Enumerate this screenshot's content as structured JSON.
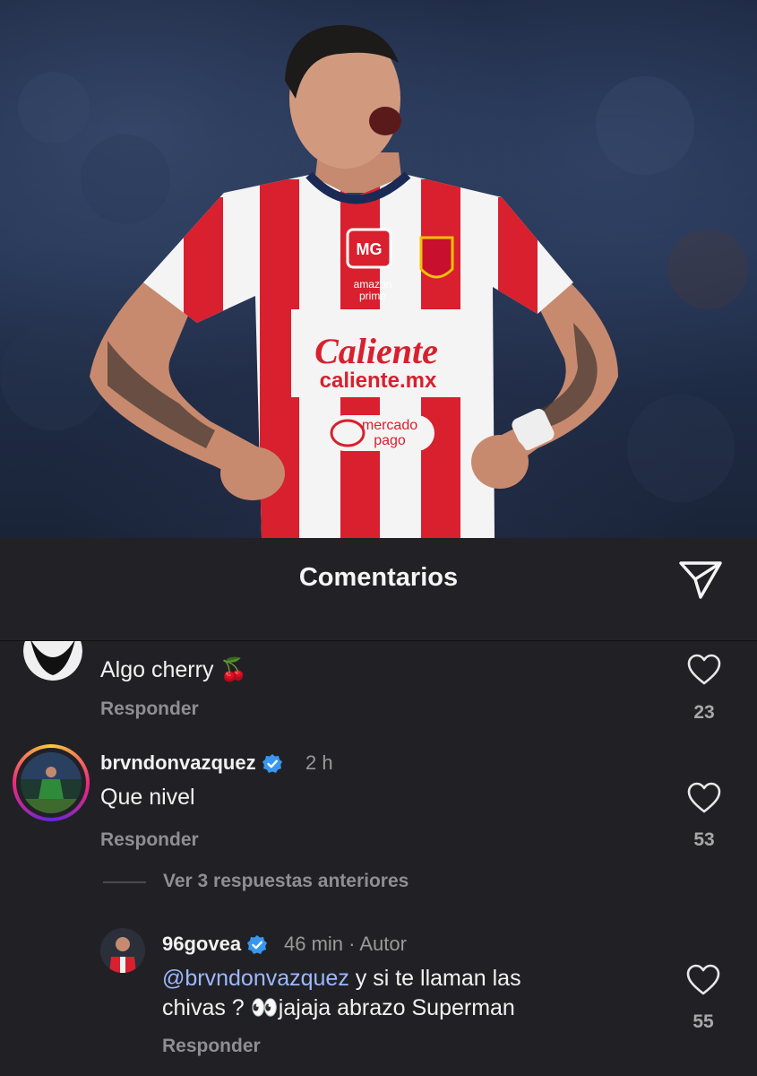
{
  "header": {
    "title": "Comentarios"
  },
  "photo": {
    "jersey_sponsor_1": "Caliente",
    "jersey_sponsor_2": "caliente.mx",
    "jersey_sponsor_3": "mercado",
    "jersey_sponsor_4": "pago",
    "jersey_sponsor_5": "amazon",
    "jersey_sponsor_6": "prime",
    "jersey_mg": "MG"
  },
  "comments": [
    {
      "username": "",
      "text": "Algo cherry",
      "emoji": "🍒",
      "reply_label": "Responder",
      "likes": "23"
    },
    {
      "username": "brvndonvazquez",
      "time": "2 h",
      "text": "Que nivel",
      "reply_label": "Responder",
      "likes": "53"
    }
  ],
  "view_replies": "Ver 3 respuestas anteriores",
  "reply": {
    "username": "96govea",
    "time": "46 min · Autor",
    "mention": "@brvndonvazquez",
    "text_line1": " y si te llaman las",
    "text_line2": "chivas ? 👀jajaja abrazo Superman",
    "reply_label": "Responder",
    "likes": "55"
  },
  "colors": {
    "accent_verified": "#3897f0",
    "mention": "#9bb8ff",
    "jersey_red": "#d8202e"
  }
}
